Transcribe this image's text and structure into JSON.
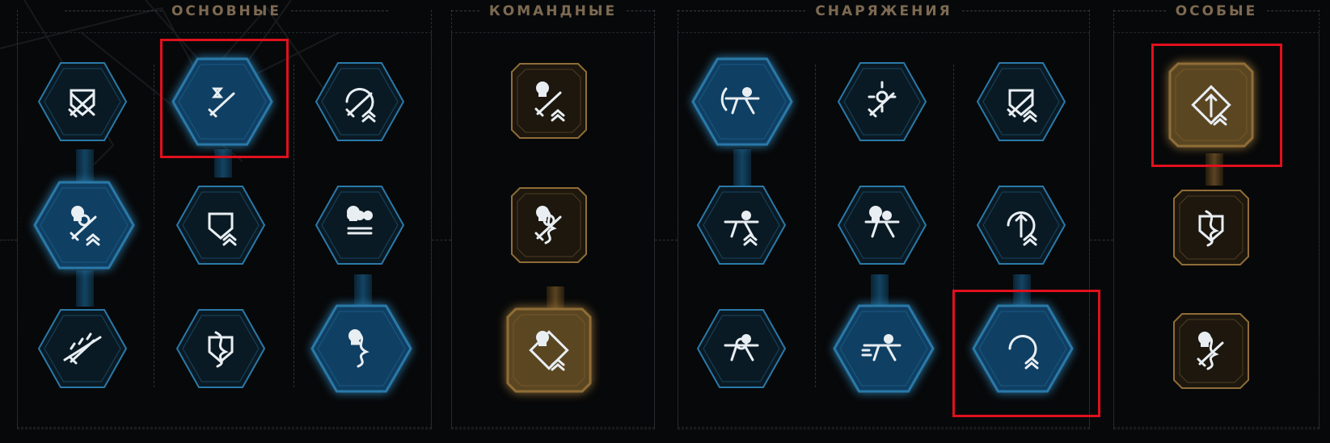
{
  "sections": [
    {
      "id": "basic",
      "title": "ОСНОВНЫЕ"
    },
    {
      "id": "team",
      "title": "КОМАНДНЫЕ"
    },
    {
      "id": "equipment",
      "title": "СНАРЯЖЕНИЯ"
    },
    {
      "id": "special",
      "title": "ОСОБЫЕ"
    }
  ],
  "colors": {
    "blue_active": "#0f3f63",
    "blue_inactive": "#0a1a24",
    "blue_border": "#2a79a8",
    "gold_active": "#5b4622",
    "gold_inactive": "#1d170e",
    "gold_border": "#8f6d37",
    "highlight": "#e1101e",
    "title": "#7d6a52"
  },
  "skills": {
    "basic": [
      {
        "icon": "crossed-blades-shield-icon",
        "active": false
      },
      {
        "icon": "blade-hourglass-icon",
        "active": true,
        "highlighted": true
      },
      {
        "icon": "blade-cycle-rank-icon",
        "active": false
      },
      {
        "icon": "skull-target-blade-rank-icon",
        "active": true
      },
      {
        "icon": "shield-rank-icon",
        "active": false
      },
      {
        "icon": "squad-skulls-grid-icon",
        "active": false
      },
      {
        "icon": "serrated-blade-icon",
        "active": false
      },
      {
        "icon": "dna-helix-shield-icon",
        "active": false
      },
      {
        "icon": "skull-helix-hourglass-icon",
        "active": true
      }
    ],
    "team": [
      {
        "icon": "skull-blade-rank-icon",
        "active": false
      },
      {
        "icon": "skull-target-blade-helix-icon",
        "active": false
      },
      {
        "icon": "skull-diamond-rank-icon",
        "active": true
      }
    ],
    "equipment": [
      {
        "icon": "soldier-bow-icon",
        "active": true
      },
      {
        "icon": "target-burst-spear-icon",
        "active": false
      },
      {
        "icon": "shield-rank-blade-icon",
        "active": false
      },
      {
        "icon": "soldier-rank-icon",
        "active": false
      },
      {
        "icon": "soldier-skull-icon",
        "active": false
      },
      {
        "icon": "cycle-arrow-rank-icon",
        "active": false
      },
      {
        "icon": "soldier-target-icon",
        "active": false
      },
      {
        "icon": "soldier-rush-icon",
        "active": true
      },
      {
        "icon": "rank-cycle-icon",
        "active": true,
        "highlighted": true
      }
    ],
    "special": [
      {
        "icon": "diamond-arrow-rank-icon",
        "active": true,
        "highlighted": true
      },
      {
        "icon": "dna-helix-shield-icon",
        "active": false
      },
      {
        "icon": "skull-blade-helix-icon",
        "active": false
      }
    ]
  }
}
